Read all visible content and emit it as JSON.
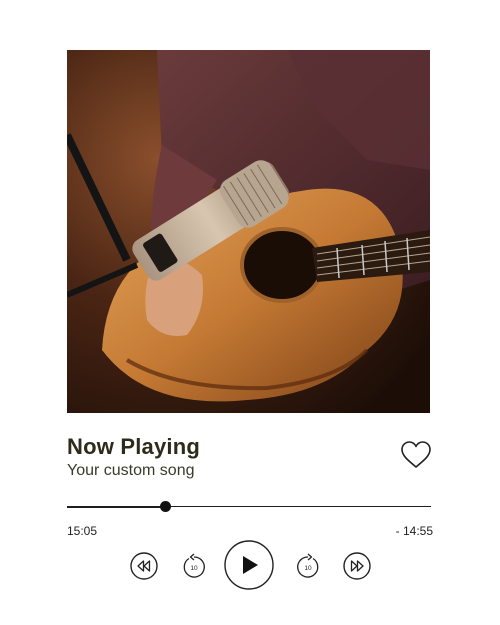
{
  "player": {
    "title": "Now Playing",
    "subtitle": "Your custom song",
    "time_elapsed": "15:05",
    "time_remaining": "- 14:55",
    "progress": 0.27,
    "skip_back_label": "10",
    "skip_forward_label": "10"
  },
  "icons": {
    "favorite": "heart-icon",
    "rewind": "rewind-icon",
    "skip_back": "replay-10-icon",
    "play": "play-icon",
    "skip_forward": "forward-10-icon",
    "fast_forward": "fast-forward-icon"
  },
  "colors": {
    "title": "#2c2c1b",
    "track": "#1e1e1e",
    "icon_stroke": "#222222",
    "background": "#ffffff"
  }
}
